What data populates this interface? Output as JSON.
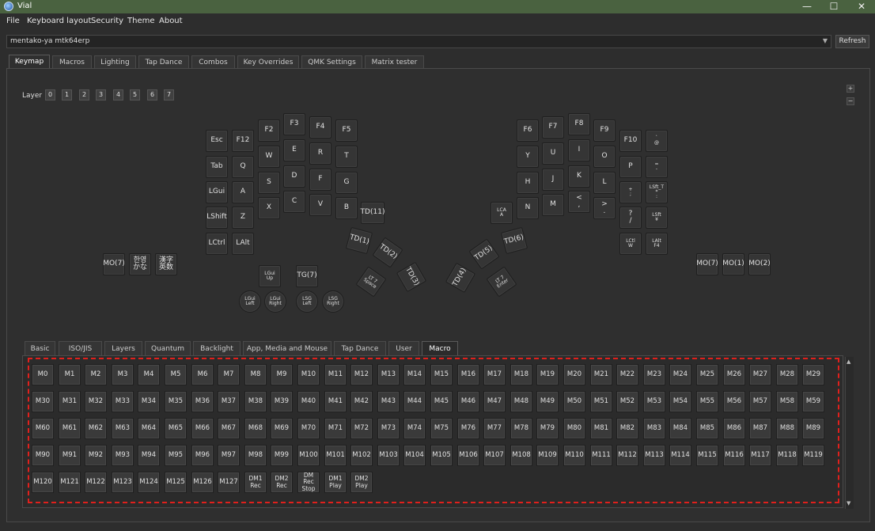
{
  "window": {
    "title": "Vial"
  },
  "menu": [
    "File",
    "Keyboard layout",
    "Security",
    "Theme",
    "About"
  ],
  "keyboard_select": {
    "value": "mentako-ya mtk64erp",
    "refresh": "Refresh"
  },
  "tabs": [
    "Keymap",
    "Macros",
    "Lighting",
    "Tap Dance",
    "Combos",
    "Key Overrides",
    "QMK Settings",
    "Matrix tester"
  ],
  "layer": {
    "label": "Layer",
    "buttons": [
      "0",
      "1",
      "2",
      "3",
      "4",
      "5",
      "6",
      "7"
    ]
  },
  "zoom": {
    "plus": "+",
    "minus": "−"
  },
  "keys": {
    "esc": "Esc",
    "f12": "F12",
    "f2": "F2",
    "f3": "F3",
    "f4": "F4",
    "f5": "F5",
    "tab": "Tab",
    "q": "Q",
    "w": "W",
    "e": "E",
    "r": "R",
    "t": "T",
    "lgui": "LGui",
    "a": "A",
    "s": "S",
    "d": "D",
    "f": "F",
    "g": "G",
    "lshift": "LShift",
    "z": "Z",
    "x": "X",
    "c": "C",
    "v": "V",
    "b": "B",
    "td11": "TD(11)",
    "lctrl": "LCtrl",
    "lalt": "LAlt",
    "mo7": "MO(7)",
    "hangul": "한영\nかな",
    "kanji": "漢字\n英数",
    "td1": "TD(1)",
    "td2": "TD(2)",
    "td3": "TD(3)",
    "lt7space": "LT 7\nSpace",
    "lgui_up": "LGui\nUp",
    "tg7": "TG(7)",
    "lgui_left": "LGui\nLeft",
    "lgui_right": "LGui\nRight",
    "lsg_left": "LSG\nLeft",
    "lsg_right": "LSG\nRight",
    "f6": "F6",
    "f7": "F7",
    "f8": "F8",
    "f9": "F9",
    "f10": "F10",
    "at": "`\n@",
    "y": "Y",
    "u": "U",
    "i": "I",
    "o": "O",
    "p": "P",
    "eq": "=\n-",
    "h": "H",
    "j": "J",
    "k": "K",
    "l": "L",
    "plus": "+\n;",
    "lsft_t": "LSft_T\n*\n:",
    "lca": "LCA\nA",
    "n": "N",
    "m": "M",
    "lt": "<\n,",
    "gt": ">\n.",
    "slash": "?\n/",
    "lsft_y": "LSft\n¥",
    "lctl_w": "LCtl\nW",
    "lalt_f4": "LAlt\nF4",
    "td6": "TD(6)",
    "td5": "TD(5)",
    "td4": "TD(4)",
    "lt7enter": "LT 7\nEnter",
    "mo7r": "MO(7)",
    "mo1": "MO(1)",
    "mo2": "MO(2)"
  },
  "subtabs": [
    "Basic",
    "ISO/JIS",
    "Layers",
    "Quantum",
    "Backlight",
    "App, Media and Mouse",
    "Tap Dance",
    "User",
    "Macro"
  ],
  "macros": [
    "M0",
    "M1",
    "M2",
    "M3",
    "M4",
    "M5",
    "M6",
    "M7",
    "M8",
    "M9",
    "M10",
    "M11",
    "M12",
    "M13",
    "M14",
    "M15",
    "M16",
    "M17",
    "M18",
    "M19",
    "M20",
    "M21",
    "M22",
    "M23",
    "M24",
    "M25",
    "M26",
    "M27",
    "M28",
    "M29",
    "M30",
    "M31",
    "M32",
    "M33",
    "M34",
    "M35",
    "M36",
    "M37",
    "M38",
    "M39",
    "M40",
    "M41",
    "M42",
    "M43",
    "M44",
    "M45",
    "M46",
    "M47",
    "M48",
    "M49",
    "M50",
    "M51",
    "M52",
    "M53",
    "M54",
    "M55",
    "M56",
    "M57",
    "M58",
    "M59",
    "M60",
    "M61",
    "M62",
    "M63",
    "M64",
    "M65",
    "M66",
    "M67",
    "M68",
    "M69",
    "M70",
    "M71",
    "M72",
    "M73",
    "M74",
    "M75",
    "M76",
    "M77",
    "M78",
    "M79",
    "M80",
    "M81",
    "M82",
    "M83",
    "M84",
    "M85",
    "M86",
    "M87",
    "M88",
    "M89",
    "M90",
    "M91",
    "M92",
    "M93",
    "M94",
    "M95",
    "M96",
    "M97",
    "M98",
    "M99",
    "M100",
    "M101",
    "M102",
    "M103",
    "M104",
    "M105",
    "M106",
    "M107",
    "M108",
    "M109",
    "M110",
    "M111",
    "M112",
    "M113",
    "M114",
    "M115",
    "M116",
    "M117",
    "M118",
    "M119",
    "M120",
    "M121",
    "M122",
    "M123",
    "M124",
    "M125",
    "M126",
    "M127",
    "DM1\nRec",
    "DM2\nRec",
    "DM Rec\nStop",
    "DM1\nPlay",
    "DM2\nPlay"
  ]
}
